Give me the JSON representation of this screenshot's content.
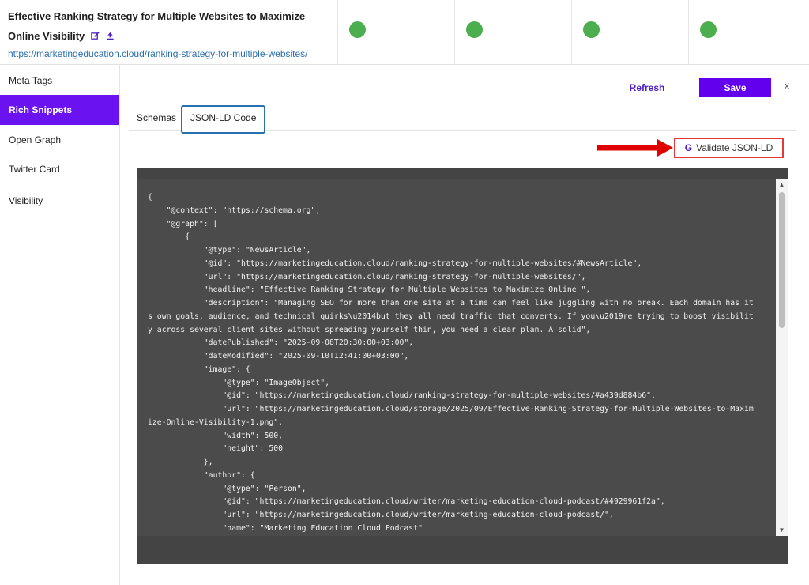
{
  "header": {
    "title": "Effective Ranking Strategy for Multiple Websites to Maximize Online Visibility",
    "url": "https://marketingeducation.cloud/ranking-strategy-for-multiple-websites/",
    "status_color": "#4cae4f"
  },
  "sidebar": {
    "items": [
      {
        "label": "Meta Tags"
      },
      {
        "label": "Rich Snippets"
      },
      {
        "label": "Open Graph"
      },
      {
        "label": "Twitter Card"
      },
      {
        "label": "Visibility"
      }
    ],
    "active_color": "#6b12f0"
  },
  "toolbar": {
    "refresh_label": "Refresh",
    "save_label": "Save",
    "close_label": "x"
  },
  "tabs": [
    {
      "label": "Schemas"
    },
    {
      "label": "JSON-LD Code"
    }
  ],
  "validate": {
    "icon_letter": "G",
    "label": "Validate JSON-LD"
  },
  "code": "{\n    \"@context\": \"https://schema.org\",\n    \"@graph\": [\n        {\n            \"@type\": \"NewsArticle\",\n            \"@id\": \"https://marketingeducation.cloud/ranking-strategy-for-multiple-websites/#NewsArticle\",\n            \"url\": \"https://marketingeducation.cloud/ranking-strategy-for-multiple-websites/\",\n            \"headline\": \"Effective Ranking Strategy for Multiple Websites to Maximize Online \",\n            \"description\": \"Managing SEO for more than one site at a time can feel like juggling with no break. Each domain has its own goals, audience, and technical quirks\\u2014but they all need traffic that converts. If you\\u2019re trying to boost visibility across several client sites without spreading yourself thin, you need a clear plan. A solid\",\n            \"datePublished\": \"2025-09-08T20:30:00+03:00\",\n            \"dateModified\": \"2025-09-10T12:41:00+03:00\",\n            \"image\": {\n                \"@type\": \"ImageObject\",\n                \"@id\": \"https://marketingeducation.cloud/ranking-strategy-for-multiple-websites/#a439d884b6\",\n                \"url\": \"https://marketingeducation.cloud/storage/2025/09/Effective-Ranking-Strategy-for-Multiple-Websites-to-Maximize-Online-Visibility-1.png\",\n                \"width\": 500,\n                \"height\": 500\n            },\n            \"author\": {\n                \"@type\": \"Person\",\n                \"@id\": \"https://marketingeducation.cloud/writer/marketing-education-cloud-podcast/#4929961f2a\",\n                \"url\": \"https://marketingeducation.cloud/writer/marketing-education-cloud-podcast/\",\n                \"name\": \"Marketing Education Cloud Podcast\""
}
